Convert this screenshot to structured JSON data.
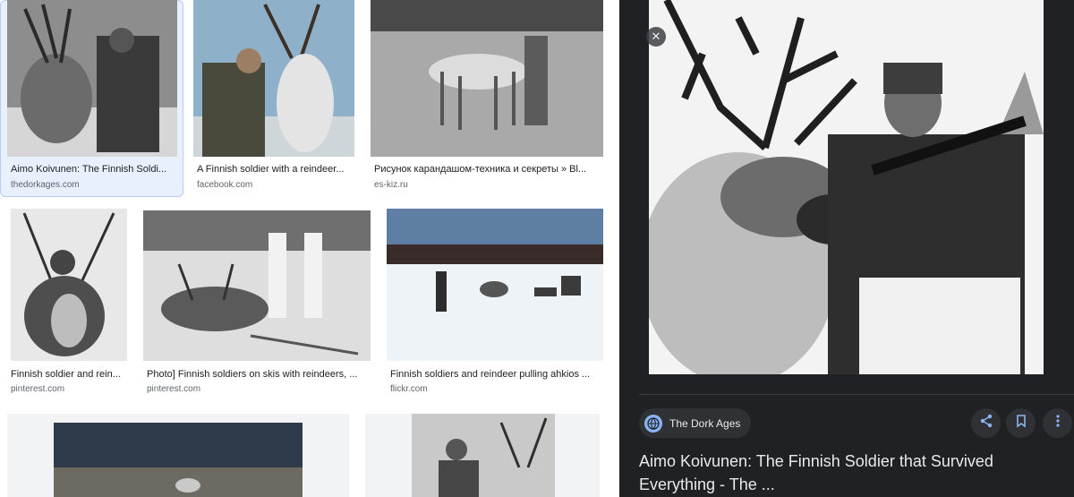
{
  "results": [
    {
      "title": "Aimo Koivunen: The Finnish Soldi...",
      "source": "thedorkages.com"
    },
    {
      "title": "A Finnish soldier with a reindeer...",
      "source": "facebook.com"
    },
    {
      "title": "Рисунок карандашом-техника и секреты » Bl...",
      "source": "es-kiz.ru"
    },
    {
      "title": "Finnish soldier and rein...",
      "source": "pinterest.com"
    },
    {
      "title": "Photo] Finnish soldiers on skis with reindeers, ...",
      "source": "pinterest.com"
    },
    {
      "title": "Finnish soldiers and reindeer pulling ahkios ...",
      "source": "flickr.com"
    }
  ],
  "panel": {
    "close_glyph": "✕",
    "source_name": "The Dork Ages",
    "title": "Aimo Koivunen: The Finnish Soldier that Survived Everything - The ...",
    "icons": {
      "globe": "globe-icon",
      "share": "share-icon",
      "save": "bookmark-icon",
      "more": "more-vert-icon"
    }
  },
  "colors": {
    "panel_bg": "#202124",
    "chip_bg": "#303134",
    "accent": "#8ab4f8",
    "selected_bg": "#e8f0fe"
  }
}
